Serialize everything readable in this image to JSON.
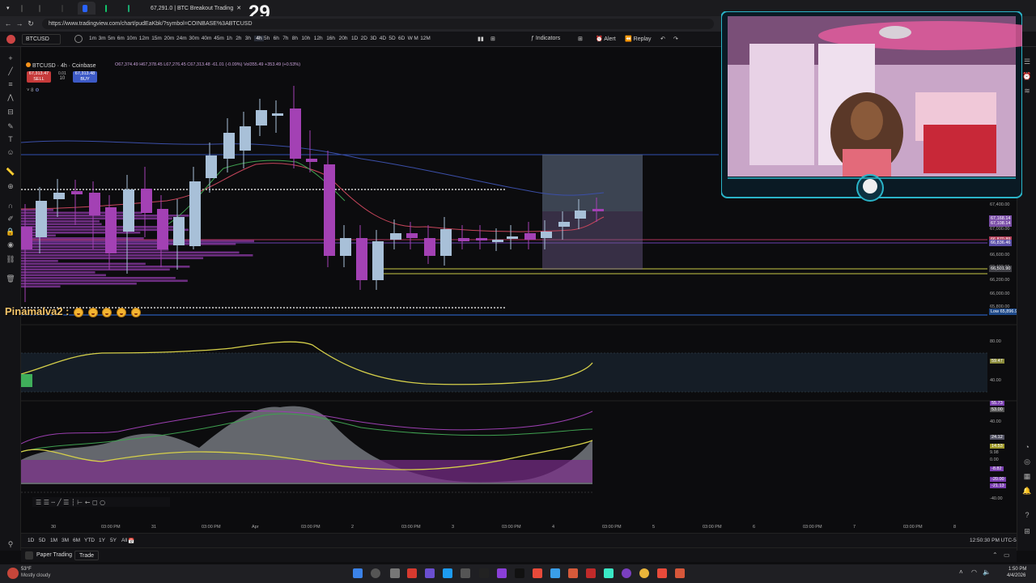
{
  "browser": {
    "tabs": [
      {
        "label": ""
      },
      {
        "label": ""
      },
      {
        "label": ""
      },
      {
        "label": ""
      },
      {
        "label": ""
      },
      {
        "label": ""
      },
      {
        "label": "67,291.0 | BTC Breakout Trading"
      }
    ],
    "url": "https://www.tradingview.com/chart/pudEaKbk/?symbol=COINBASE%3ABTCUSD",
    "stream_counter": "29"
  },
  "toolbar": {
    "symbol": "BTCUSD",
    "timeframes": [
      "1m",
      "3m",
      "5m",
      "6m",
      "10m",
      "12m",
      "15m",
      "20m",
      "24m",
      "30m",
      "40m",
      "45m",
      "1h",
      "2h",
      "3h",
      "4h",
      "5h",
      "6h",
      "7h",
      "8h",
      "10h",
      "12h",
      "16h",
      "20h",
      "1D",
      "2D",
      "3D",
      "4D",
      "5D",
      "6D",
      "W",
      "M",
      "12M"
    ],
    "selected_timeframe": "4h",
    "indicators_label": "Indicators",
    "alert_label": "Alert",
    "replay_label": "Replay"
  },
  "legend": {
    "title": "BTCUSD · 4h · Coinbase",
    "ohlc": "O67,374.49 H67,378.45 L67,276.45 C67,313.48 -61.01 (-0.09%) Vol355.49 +353.49 (+0.53%)",
    "sell_price": "67,313.47",
    "sell_label": "SELL",
    "spread_top": "0.01",
    "spread_qty": "10",
    "buy_price": "67,313.48",
    "buy_label": "BUY",
    "indicator_count": "8"
  },
  "price_axis": {
    "labels": [
      "67,400.00",
      "67,000.00",
      "66,800.00",
      "66,600.00",
      "66,400.00",
      "66,200.00",
      "66,000.00",
      "65,800.00"
    ],
    "tags": [
      {
        "text": "67,168.14",
        "color": "#7b4fa8"
      },
      {
        "text": "67,108.14",
        "color": "#7b4fa8"
      },
      {
        "text": "66,870.89",
        "color": "#b03a55"
      },
      {
        "text": "66,836.46",
        "color": "#5b4fa8"
      },
      {
        "text": "66,501.90",
        "color": "#3f3f45"
      },
      {
        "text": "Low 65,896.96",
        "color": "#1f4a8a"
      }
    ]
  },
  "oscillator1_axis": {
    "labels": [
      "80.00",
      "59.47",
      "40.00"
    ]
  },
  "oscillator2_axis": {
    "labels": [
      "55.73",
      "53.00",
      "40.00",
      "24.12",
      "14.53",
      "9.98",
      "0.00",
      "-8.82",
      "-20.00",
      "-21.13",
      "-40.00"
    ]
  },
  "time_axis": {
    "labels": [
      "30",
      "03:00 PM",
      "31",
      "03:00 PM",
      "Apr",
      "03:00 PM",
      "2",
      "03:00 PM",
      "3",
      "03:00 PM",
      "4",
      "03:00 PM",
      "5",
      "03:00 PM",
      "6",
      "03:00 PM",
      "7",
      "03:00 PM",
      "8"
    ],
    "clock": "12:50:30 PM UTC-5"
  },
  "bottom": {
    "ranges": [
      "1D",
      "5D",
      "1M",
      "3M",
      "6M",
      "YTD",
      "1Y",
      "5Y",
      "All"
    ],
    "paper_trading": "Paper Trading",
    "trade": "Trade"
  },
  "chat": {
    "username": "Pinamalva2 :"
  },
  "taskbar": {
    "weather_temp": "53°F",
    "weather_desc": "Mostly cloudy",
    "time": "1:50 PM",
    "date": "4/4/2026"
  },
  "colors": {
    "bull": "#a8c0d8",
    "bear": "#a341b4",
    "accent": "#2962ff"
  }
}
